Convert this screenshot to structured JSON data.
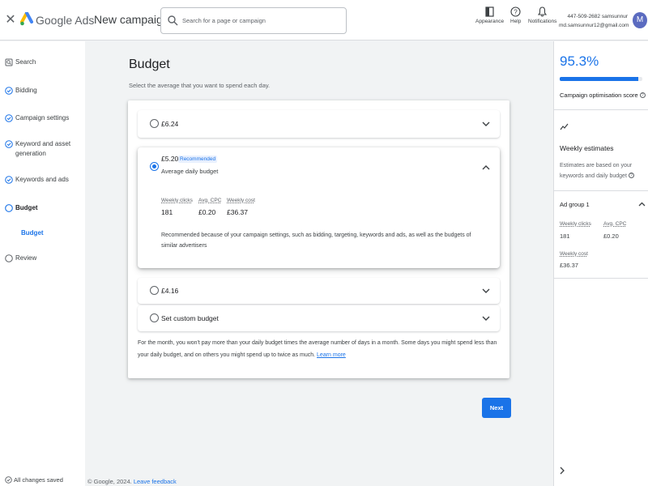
{
  "topbar": {
    "brand": "Google Ads",
    "campaign_title": "New campaign",
    "search_placeholder": "Search for a page or campaign",
    "tools": [
      {
        "label": "Appearance",
        "icon": "appearance-icon"
      },
      {
        "label": "Help",
        "icon": "help-icon"
      },
      {
        "label": "Notifications",
        "icon": "bell-icon"
      }
    ],
    "account_id": "447-509-2682 samsunnur",
    "account_email": "md.samsunnur12@gmail.com",
    "avatar_initial": "M"
  },
  "sidebar": {
    "items": [
      {
        "label": "Search",
        "icon": "search-step-icon"
      },
      {
        "label": "Bidding",
        "icon": "check-circle-icon"
      },
      {
        "label": "Campaign settings",
        "icon": "check-circle-icon"
      },
      {
        "label": "Keyword and asset generation",
        "icon": "check-circle-icon"
      },
      {
        "label": "Keywords and ads",
        "icon": "check-circle-icon"
      },
      {
        "label": "Budget",
        "icon": "current-step-icon"
      },
      {
        "label": "Review",
        "icon": "empty-circle-icon"
      }
    ],
    "sub_item": "Budget",
    "saved_status": "All changes saved"
  },
  "main": {
    "title": "Budget",
    "subtitle": "Select the average that you want to spend each day.",
    "options": [
      {
        "label": "£6.24",
        "selected": false
      },
      {
        "label": "£5.20",
        "badge": "Recommended",
        "sub": "Average daily budget",
        "selected": true,
        "metrics": [
          {
            "label": "Weekly clicks",
            "value": "181"
          },
          {
            "label": "Avg. CPC",
            "value": "£0.20"
          },
          {
            "label": "Weekly cost",
            "value": "£36.37"
          }
        ],
        "reason": "Recommended because of your campaign settings, such as bidding, targeting, keywords and ads, as well as the budgets of similar advertisers"
      },
      {
        "label": "£4.16",
        "selected": false
      },
      {
        "label": "Set custom budget",
        "selected": false
      }
    ],
    "month_note": "For the month, you won't pay more than your daily budget times the average number of days in a month. Some days you might spend less than your daily budget, and on others you might spend up to twice as much.",
    "learn_more": "Learn more",
    "next_label": "Next",
    "footer_text": "© Google, 2024.",
    "feedback_link": "Leave feedback"
  },
  "right_panel": {
    "score": "95.3%",
    "score_fraction": 0.953,
    "score_label": "Campaign optimisation score",
    "estimates_title": "Weekly estimates",
    "estimates_desc": "Estimates are based on your keywords and daily budget",
    "ad_group": "Ad group 1",
    "metrics": [
      {
        "label": "Weekly clicks",
        "value": "181"
      },
      {
        "label": "Avg. CPC",
        "value": "£0.20"
      },
      {
        "label": "Weekly cost",
        "value": "£36.37"
      }
    ]
  },
  "colors": {
    "accent": "#1a73e8",
    "avatar": "#5b6bc0",
    "background": "#f1f3f4"
  }
}
